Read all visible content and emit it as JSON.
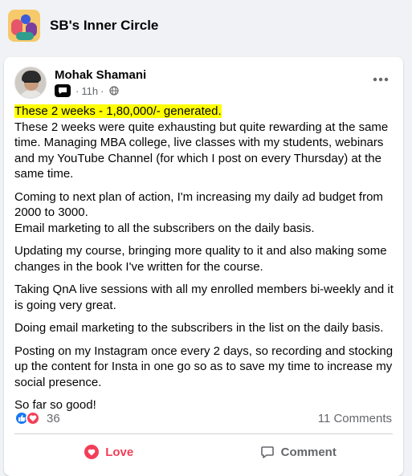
{
  "group": {
    "name": "SB's Inner Circle",
    "avatar_icon": "group-avatar-illustration"
  },
  "post": {
    "author": "Mohak Shamani",
    "time": "11h",
    "audience_icon": "globe-icon",
    "badge_icon": "chat-badge-icon",
    "highlight_color": "#ffff00",
    "headline": "These 2 weeks - 1,80,000/- generated.",
    "paragraphs": [
      "These 2 weeks were quite exhausting but quite rewarding at the same time. Managing MBA college, live classes with my students, webinars and my YouTube Channel (for which I post on every Thursday) at the same time.",
      "Coming to next plan of action, I'm increasing my daily ad budget from 2000 to 3000.\nEmail marketing to all the subscribers on the daily basis.",
      "Updating my course, bringing more quality to it and also making some changes in the book I've written for the course.",
      "Taking QnA live sessions with all my enrolled members bi-weekly and it is going very great.",
      "Doing email marketing to the subscribers in the list on the daily basis.",
      "Posting on my Instagram once every 2 days, so recording and stocking up the content for Insta in one go so as to save my time to increase my social presence.",
      "So far so good!"
    ]
  },
  "stats": {
    "reaction_count": "36",
    "comments": "11 Comments",
    "like_color": "#1877f2",
    "love_color": "#f33e58"
  },
  "actions": {
    "love_label": "Love",
    "comment_label": "Comment"
  }
}
